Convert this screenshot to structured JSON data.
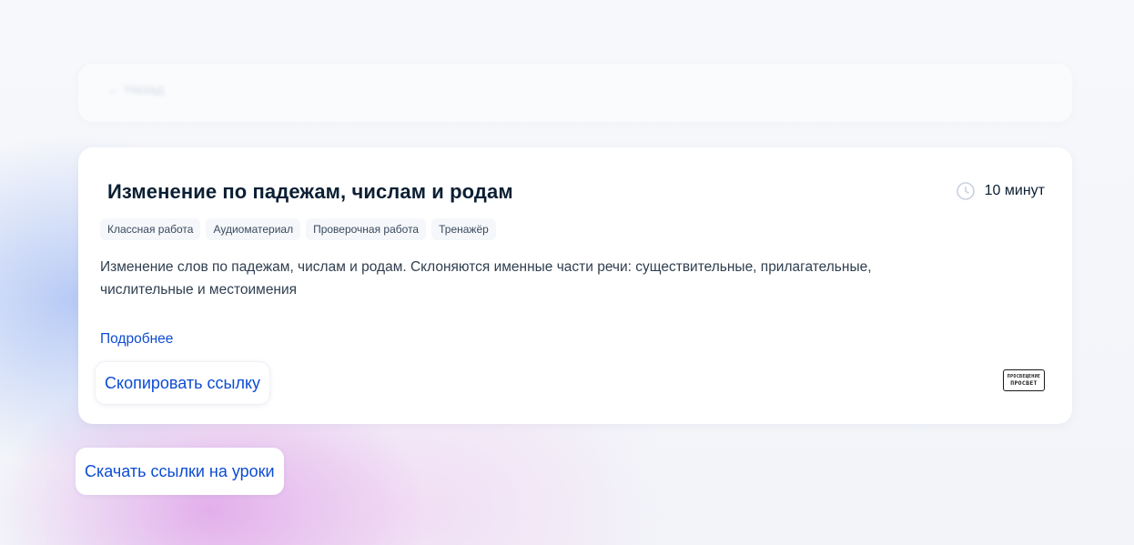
{
  "top_card": {
    "ghost_text": "← Назад"
  },
  "lesson": {
    "title": "Изменение по падежам, числам и родам",
    "duration": "10 минут",
    "tags": [
      "Классная работа",
      "Аудиоматериал",
      "Проверочная работа",
      "Тренажёр"
    ],
    "description": "Изменение слов по падежам, числам и родам. Склоняются именные части речи: существительные, прилагательные, числительные и местоимения",
    "more_label": "Подробнее",
    "copy_link_label": "Скопировать ссылку",
    "publisher_logo_line1": "ПРОСВЕЩЕНИЕ",
    "publisher_logo_line2": "ПРОСВЕТ"
  },
  "footer": {
    "download_label": "Скачать ссылки на уроки"
  },
  "colors": {
    "link": "#0d4cd3",
    "title": "#0b1f33",
    "tag_bg": "#f5f7fa"
  },
  "icons": {
    "duration": "clock-icon"
  }
}
